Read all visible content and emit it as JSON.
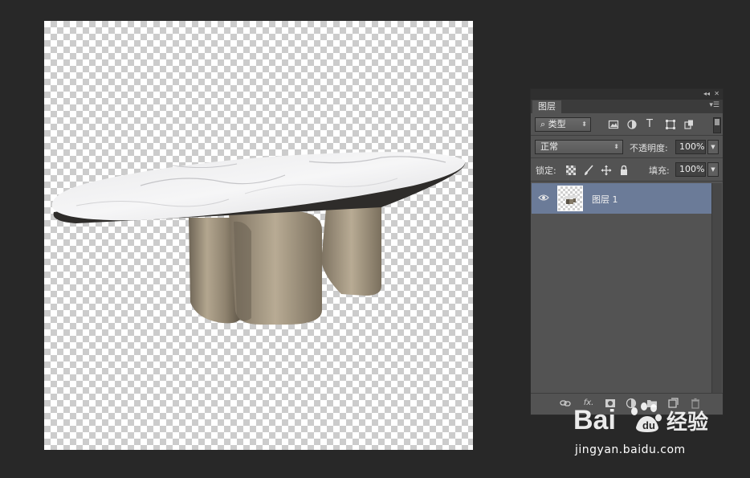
{
  "panel": {
    "tab_label": "图层",
    "filter_label": "类型",
    "blend_mode": "正常",
    "opacity_label": "不透明度:",
    "opacity_value": "100%",
    "lock_label": "锁定:",
    "fill_label": "填充:",
    "fill_value": "100%",
    "filter_icons": [
      "image-filter-icon",
      "adjustment-filter-icon",
      "text-filter-icon",
      "shape-filter-icon",
      "smart-object-filter-icon"
    ],
    "lock_icons": [
      "lock-transparent-pixels-icon",
      "lock-image-pixels-icon",
      "lock-position-icon",
      "lock-all-icon"
    ],
    "layers": [
      {
        "name": "图层 1",
        "visible": true,
        "selected": true
      }
    ],
    "bottom_icons": [
      "link-layers-icon",
      "fx-icon",
      "add-mask-icon",
      "new-adjustment-layer-icon",
      "new-group-icon",
      "new-layer-icon",
      "delete-layer-icon"
    ],
    "fx_label": "fx."
  },
  "watermark": {
    "brand": "Bai",
    "brand_suffix": "经验",
    "url": "jingyan.baidu.com"
  },
  "colors": {
    "workspace": "#282828",
    "panel": "#535353",
    "selected_layer": "#6b7b98"
  }
}
